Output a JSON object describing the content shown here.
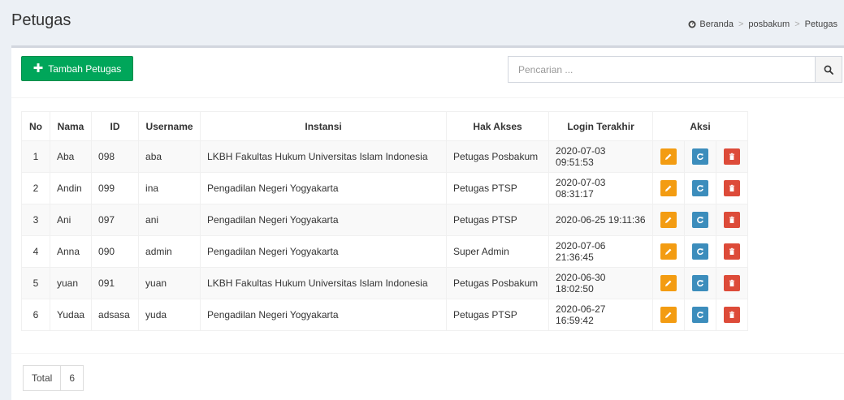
{
  "page": {
    "title": "Petugas"
  },
  "breadcrumb": {
    "home": "Beranda",
    "section": "posbakum",
    "current": "Petugas"
  },
  "toolbar": {
    "add_label": "Tambah Petugas",
    "search_placeholder": "Pencarian ..."
  },
  "table": {
    "headers": {
      "no": "No",
      "nama": "Nama",
      "id": "ID",
      "username": "Username",
      "instansi": "Instansi",
      "hak_akses": "Hak Akses",
      "login_terakhir": "Login Terakhir",
      "aksi": "Aksi"
    },
    "rows": [
      {
        "no": "1",
        "nama": "Aba",
        "id": "098",
        "username": "aba",
        "instansi": "LKBH Fakultas Hukum Universitas Islam Indonesia",
        "hak_akses": "Petugas Posbakum",
        "login_terakhir": "2020-07-03 09:51:53"
      },
      {
        "no": "2",
        "nama": "Andin",
        "id": "099",
        "username": "ina",
        "instansi": "Pengadilan Negeri Yogyakarta",
        "hak_akses": "Petugas PTSP",
        "login_terakhir": "2020-07-03 08:31:17"
      },
      {
        "no": "3",
        "nama": "Ani",
        "id": "097",
        "username": "ani",
        "instansi": "Pengadilan Negeri Yogyakarta",
        "hak_akses": "Petugas PTSP",
        "login_terakhir": "2020-06-25 19:11:36"
      },
      {
        "no": "4",
        "nama": "Anna",
        "id": "090",
        "username": "admin",
        "instansi": "Pengadilan Negeri Yogyakarta",
        "hak_akses": "Super Admin",
        "login_terakhir": "2020-07-06 21:36:45"
      },
      {
        "no": "5",
        "nama": "yuan",
        "id": "091",
        "username": "yuan",
        "instansi": "LKBH Fakultas Hukum Universitas Islam Indonesia",
        "hak_akses": "Petugas Posbakum",
        "login_terakhir": "2020-06-30 18:02:50"
      },
      {
        "no": "6",
        "nama": "Yudaa",
        "id": "adsasa",
        "username": "yuda",
        "instansi": "Pengadilan Negeri Yogyakarta",
        "hak_akses": "Petugas PTSP",
        "login_terakhir": "2020-06-27 16:59:42"
      }
    ]
  },
  "footer": {
    "total_label": "Total",
    "total_value": "6"
  },
  "colors": {
    "add_button": "#00a65a",
    "edit_button": "#f39c12",
    "reset_button": "#3c8dbc",
    "delete_button": "#dd4b39"
  },
  "icons": {
    "breadcrumb_home": "dashboard-icon",
    "add": "plus-icon",
    "search": "search-icon",
    "edit": "pencil-icon",
    "reset": "refresh-icon",
    "delete": "trash-icon"
  }
}
